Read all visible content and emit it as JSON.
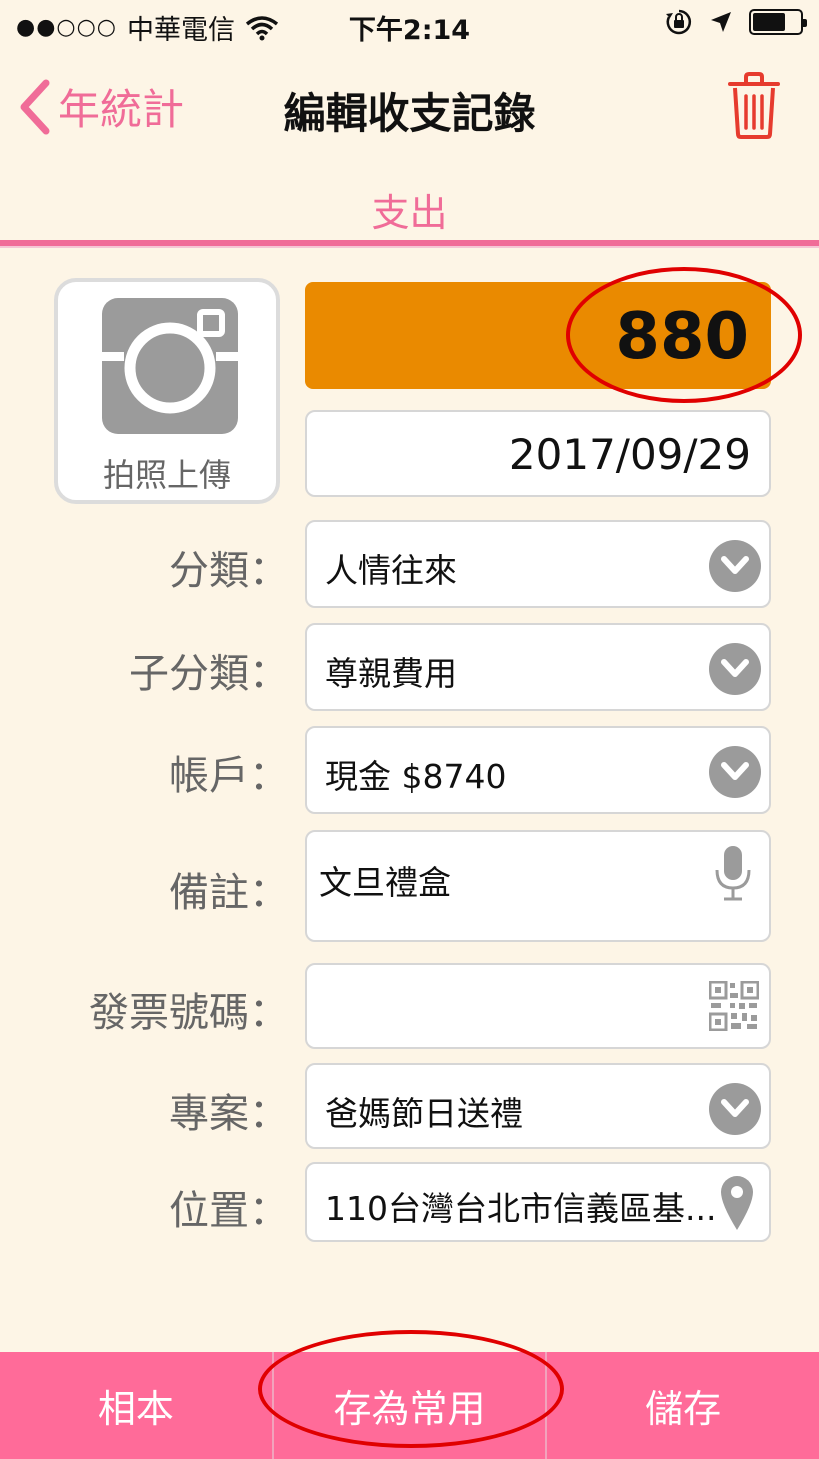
{
  "status": {
    "carrier": "中華電信",
    "time": "下午2:14",
    "battery_level": 0.7
  },
  "nav": {
    "back_label": "年統計",
    "title": "編輯收支記錄"
  },
  "segment": "支出",
  "photo": {
    "label": "拍照上傳"
  },
  "amount": "880",
  "date": "2017/09/29",
  "rows": {
    "category": {
      "label": "分類：",
      "value": "人情往來"
    },
    "subcategory": {
      "label": "子分類：",
      "value": "尊親費用"
    },
    "account": {
      "label": "帳戶：",
      "value": "現金 $8740"
    },
    "note": {
      "label": "備註：",
      "value": "文旦禮盒"
    },
    "invoice": {
      "label": "發票號碼：",
      "value": ""
    },
    "project": {
      "label": "專案：",
      "value": "爸媽節日送禮"
    },
    "location": {
      "label": "位置：",
      "value": "110台灣台北市信義區基..."
    }
  },
  "bottom": {
    "album": "相本",
    "save_common": "存為常用",
    "save": "儲存"
  },
  "colors": {
    "background": "#fdf5e6",
    "accent_pink": "#f06c98",
    "amount_orange": "#ea8a00",
    "bottom_bar": "#ff6b99",
    "annotation_red": "#e00000"
  },
  "icons": [
    "signal-dots-icon",
    "wifi-icon",
    "rotation-lock-icon",
    "location-arrow-icon",
    "battery-icon",
    "chevron-left-icon",
    "trash-icon",
    "camera-icon",
    "dropdown-icon",
    "microphone-icon",
    "qr-code-icon",
    "map-pin-icon"
  ]
}
